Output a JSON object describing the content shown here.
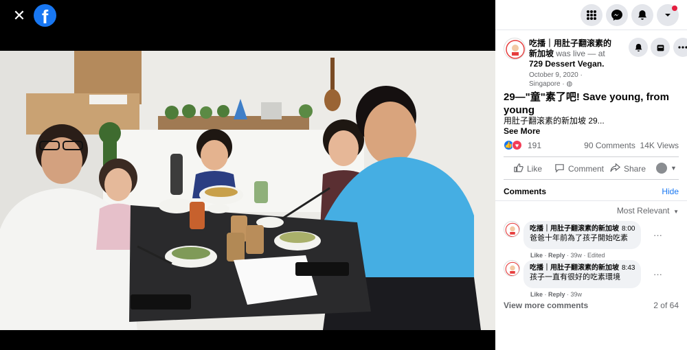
{
  "viewer": {
    "close_icon": "close-icon",
    "logo_icon": "facebook-logo-icon"
  },
  "nav": {
    "icons": [
      "menu-grid-icon",
      "messenger-icon",
      "notifications-bell-icon",
      "account-caret-icon"
    ]
  },
  "post": {
    "author": "吃播｜用肚子翻滚素的新加坡",
    "was_live_text": " was live — at ",
    "place": "729 Dessert Vegan.",
    "date": "October 9, 2020 ·",
    "location": "Singapore ·",
    "title": "29—\"童\"素了吧!   Save young, from young",
    "body": "用肚子翻滚素的新加坡 29...",
    "see_more": "See More",
    "reaction_count": "191",
    "comments_count": "90 Comments",
    "views_count": "14K Views"
  },
  "actions": {
    "like": "Like",
    "comment": "Comment",
    "share": "Share"
  },
  "comments_section": {
    "header": "Comments",
    "hide": "Hide",
    "sort": "Most Relevant",
    "items": [
      {
        "author": "吃播｜用肚子翻滚素的新加坡",
        "time": "8:00",
        "text": "爸爸十年前為了孩子開始吃素",
        "like": "Like",
        "reply": "Reply",
        "age": "39w",
        "edited": "Edited"
      },
      {
        "author": "吃播｜用肚子翻滚素的新加坡",
        "time": "8:43",
        "text": "孩子一直有很好的吃素環境",
        "like": "Like",
        "reply": "Reply",
        "age": "39w",
        "edited": ""
      }
    ],
    "view_more": "View more comments",
    "page_count": "2 of 64"
  },
  "colors": {
    "brand": "#1877f2",
    "notification": "#e41e3f",
    "shirt": "#45aee3"
  }
}
